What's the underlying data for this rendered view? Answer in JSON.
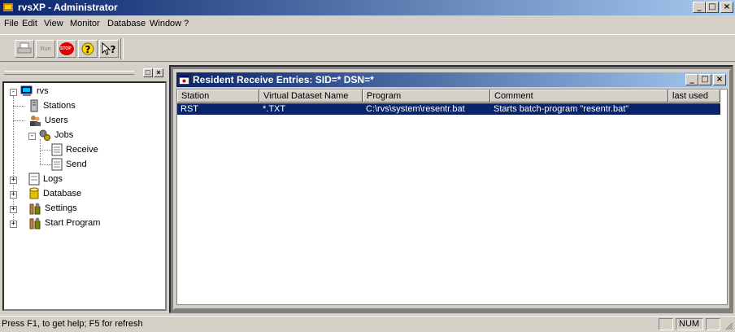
{
  "window": {
    "title": "rvsXP - Administrator"
  },
  "menu": [
    "File",
    "Edit",
    "View",
    "Monitor",
    "Database",
    "Window",
    "?"
  ],
  "toolbar": {
    "run_label": "Run",
    "stop_label": "STOP"
  },
  "tree": {
    "root": "rvs",
    "items": [
      "Stations",
      "Users",
      "Jobs",
      "Receive",
      "Send",
      "Logs",
      "Database",
      "Settings",
      "Start Program"
    ]
  },
  "child_window": {
    "title": "Resident Receive Entries: SID=*  DSN=*",
    "columns": [
      "Station",
      "Virtual Dataset Name",
      "Program",
      "Comment",
      "last used"
    ],
    "rows": [
      [
        "RST",
        "*.TXT",
        "C:\\rvs\\system\\resentr.bat",
        "Starts batch-program \"resentr.bat\"",
        ""
      ]
    ]
  },
  "status": {
    "text": "Press F1, to get help; F5 for refresh",
    "num": "NUM"
  },
  "colors": {
    "title_active": "#0a246a",
    "face": "#d4d0c8",
    "selection": "#0a246a"
  }
}
